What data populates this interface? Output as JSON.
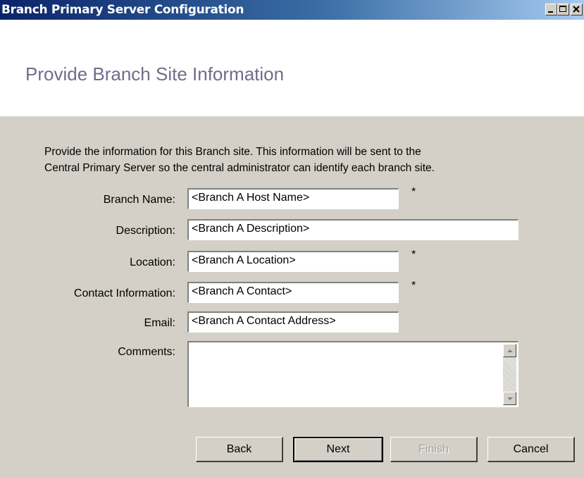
{
  "window": {
    "title": "Branch Primary Server Configuration"
  },
  "header": {
    "heading": "Provide Branch Site Information"
  },
  "intro": {
    "line1": "Provide the information for this Branch site. This information will be sent to the",
    "line2": "Central Primary Server so the central administrator can identify each branch site."
  },
  "form": {
    "branch_name": {
      "label": "Branch Name:",
      "value": "<Branch A Host Name>",
      "required_mark": "*"
    },
    "description": {
      "label": "Description:",
      "value": "<Branch A Description>"
    },
    "location": {
      "label": "Location:",
      "value": "<Branch A Location>",
      "required_mark": "*"
    },
    "contact": {
      "label": "Contact Information:",
      "value": "<Branch A Contact>",
      "required_mark": "*"
    },
    "email": {
      "label": "Email:",
      "value": "<Branch A Contact Address>"
    },
    "comments": {
      "label": "Comments:",
      "value": ""
    }
  },
  "buttons": {
    "back": "Back",
    "next": "Next",
    "finish": "Finish",
    "cancel": "Cancel"
  },
  "icons": [
    "minimize-icon",
    "maximize-icon",
    "close-icon",
    "scroll-up-arrow-icon",
    "scroll-down-arrow-icon"
  ],
  "colors": {
    "titlebar_start": "#0a246a",
    "titlebar_end": "#a6caf0",
    "heading": "#6e6e8c",
    "dialog_bg": "#d4d0c8"
  }
}
